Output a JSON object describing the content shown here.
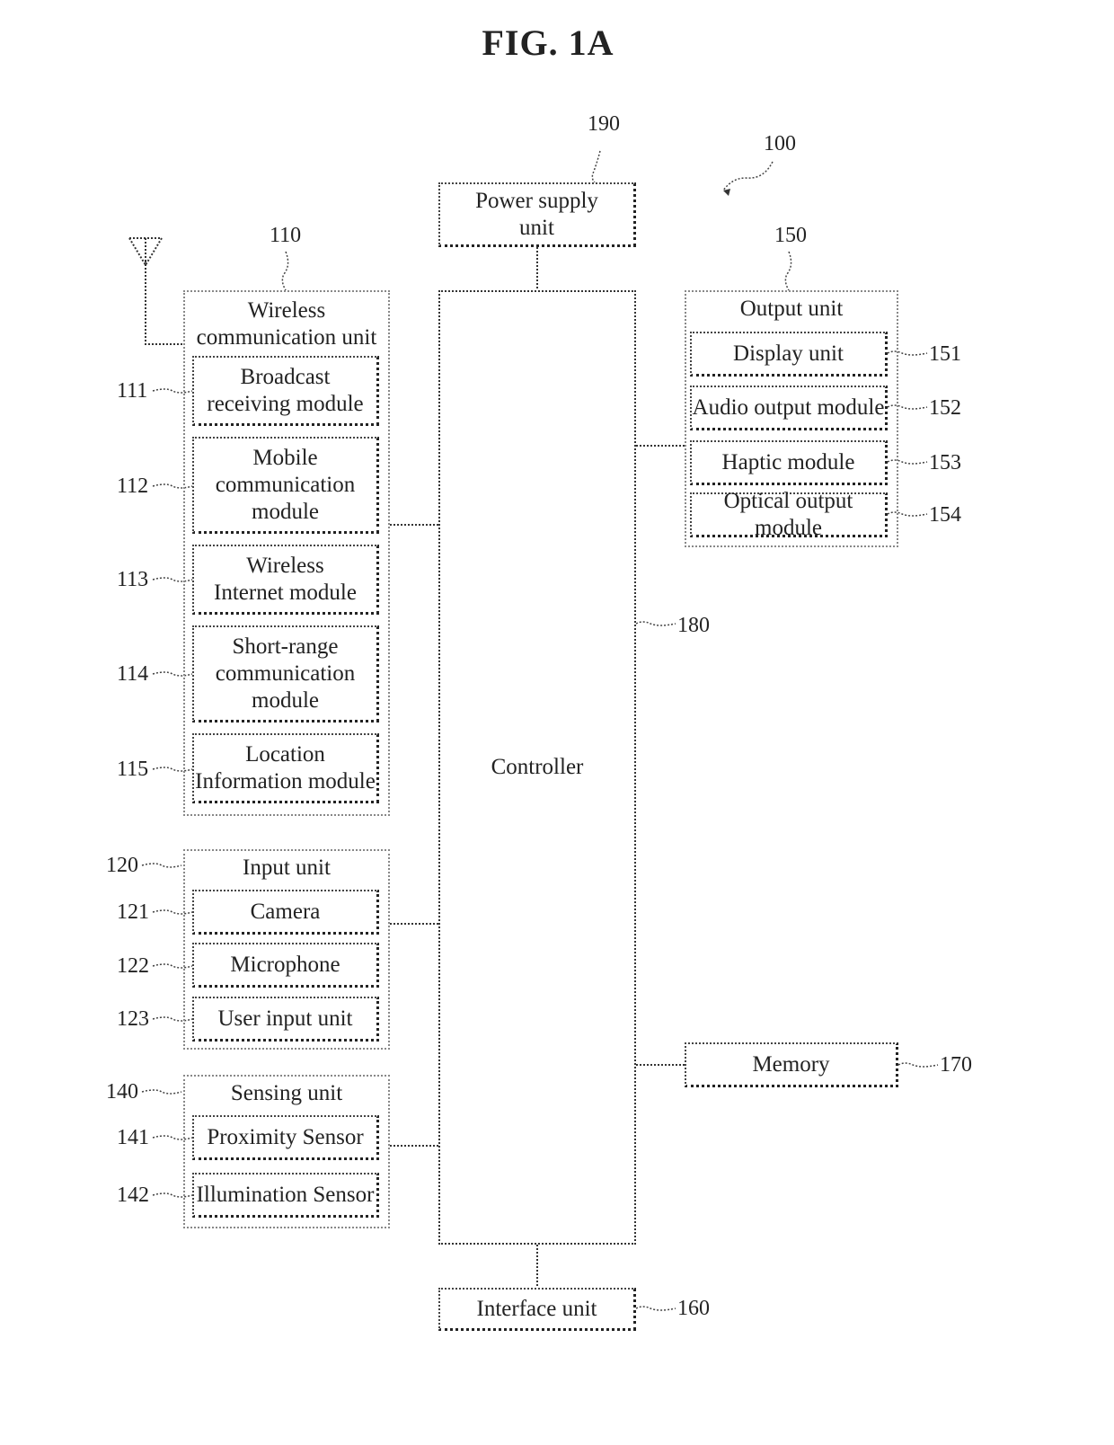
{
  "figure": {
    "title": "FIG. 1A",
    "device_ref": "100"
  },
  "power_supply": {
    "ref": "190",
    "label_line1": "Power supply",
    "label_line2": "unit"
  },
  "controller": {
    "ref": "180",
    "label": "Controller"
  },
  "interface": {
    "ref": "160",
    "label": "Interface unit"
  },
  "memory": {
    "ref": "170",
    "label": "Memory"
  },
  "wireless_unit": {
    "ref": "110",
    "title_line1": "Wireless",
    "title_line2": "communication unit",
    "icon": "antenna-icon",
    "modules": [
      {
        "ref": "111",
        "lines": [
          "Broadcast",
          "receiving module"
        ]
      },
      {
        "ref": "112",
        "lines": [
          "Mobile",
          "communication",
          "module"
        ]
      },
      {
        "ref": "113",
        "lines": [
          "Wireless",
          "Internet module"
        ]
      },
      {
        "ref": "114",
        "lines": [
          "Short-range",
          "communication",
          "module"
        ]
      },
      {
        "ref": "115",
        "lines": [
          "Location",
          "Information module"
        ]
      }
    ]
  },
  "input_unit": {
    "ref": "120",
    "title": "Input unit",
    "modules": [
      {
        "ref": "121",
        "label": "Camera"
      },
      {
        "ref": "122",
        "label": "Microphone"
      },
      {
        "ref": "123",
        "label": "User input unit"
      }
    ]
  },
  "sensing_unit": {
    "ref": "140",
    "title": "Sensing unit",
    "modules": [
      {
        "ref": "141",
        "label": "Proximity Sensor"
      },
      {
        "ref": "142",
        "label": "Illumination Sensor"
      }
    ]
  },
  "output_unit": {
    "ref": "150",
    "title": "Output unit",
    "modules": [
      {
        "ref": "151",
        "label": "Display unit"
      },
      {
        "ref": "152",
        "label": "Audio output module"
      },
      {
        "ref": "153",
        "label": "Haptic module"
      },
      {
        "ref": "154",
        "label": "Optical output module"
      }
    ]
  }
}
